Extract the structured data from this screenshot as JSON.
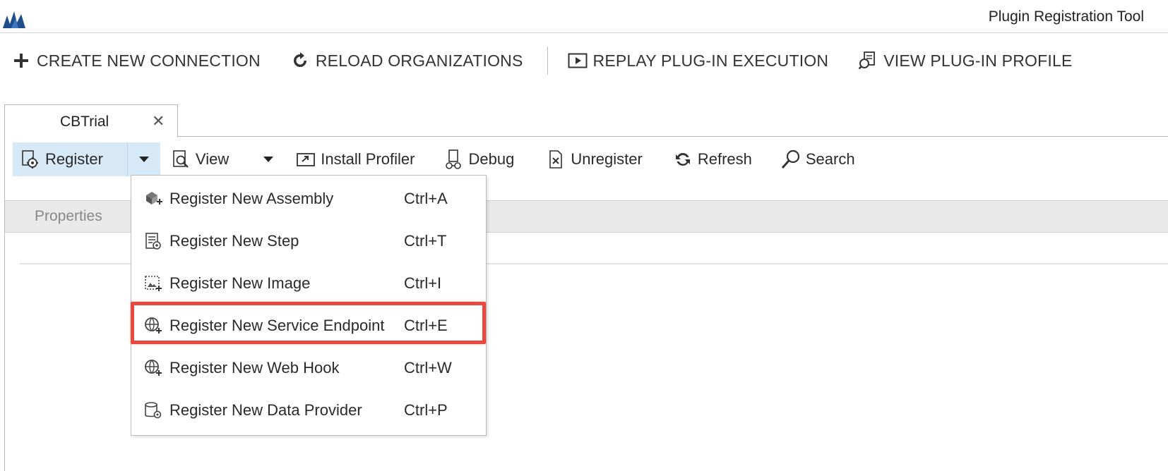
{
  "window": {
    "title": "Plugin Registration Tool",
    "logo_icon": "dynamics-logo-icon"
  },
  "top_toolbar": {
    "create_connection": "CREATE NEW CONNECTION",
    "reload_organizations": "RELOAD ORGANIZATIONS",
    "replay_execution": "REPLAY PLUG-IN EXECUTION",
    "view_profile": "VIEW PLUG-IN PROFILE"
  },
  "tab": {
    "label": "CBTrial",
    "close": "✕"
  },
  "toolbar": {
    "register": "Register",
    "view": "View",
    "install_profiler": "Install Profiler",
    "debug": "Debug",
    "unregister": "Unregister",
    "refresh": "Refresh",
    "search": "Search"
  },
  "properties": {
    "label": "Properties"
  },
  "register_menu": {
    "items": [
      {
        "label": "Register New Assembly",
        "shortcut": "Ctrl+A",
        "icon": "assembly-icon"
      },
      {
        "label": "Register New Step",
        "shortcut": "Ctrl+T",
        "icon": "step-icon"
      },
      {
        "label": "Register New Image",
        "shortcut": "Ctrl+I",
        "icon": "image-icon"
      },
      {
        "label": "Register New Service Endpoint",
        "shortcut": "Ctrl+E",
        "icon": "service-endpoint-icon",
        "highlighted": true
      },
      {
        "label": "Register New Web Hook",
        "shortcut": "Ctrl+W",
        "icon": "web-hook-icon"
      },
      {
        "label": "Register New Data Provider",
        "shortcut": "Ctrl+P",
        "icon": "data-provider-icon"
      }
    ]
  },
  "colors": {
    "accent_selected": "#d7e9f7",
    "highlight_border": "#e8483e",
    "logo": "#1f4e8c"
  }
}
